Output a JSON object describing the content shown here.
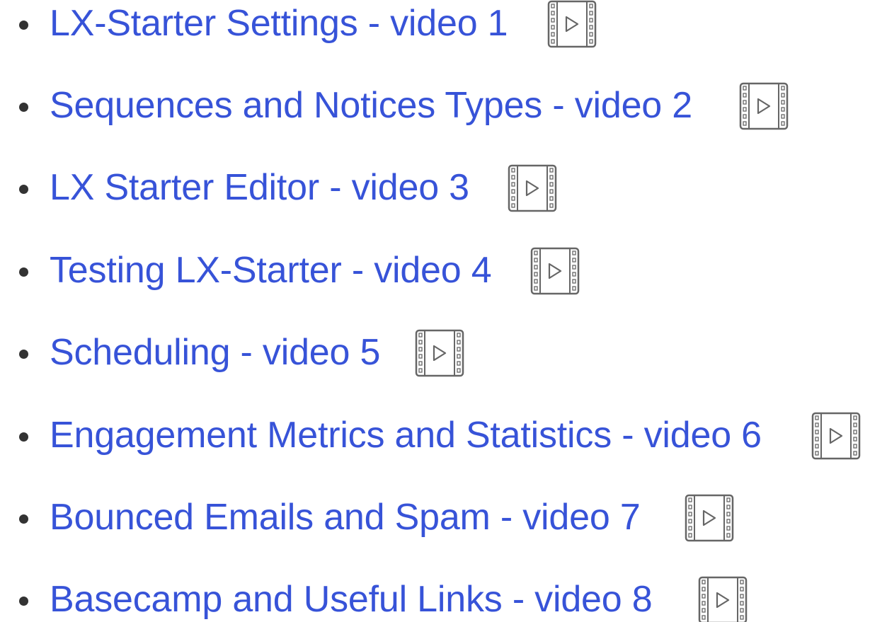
{
  "videos": [
    {
      "label": "LX-Starter Settings - video 1",
      "icon": "video-icon"
    },
    {
      "label": "Sequences and Notices Types - video 2",
      "icon": "video-icon"
    },
    {
      "label": "LX Starter Editor - video 3",
      "icon": "video-icon"
    },
    {
      "label": "Testing LX-Starter - video 4",
      "icon": "video-icon"
    },
    {
      "label": "Scheduling - video 5",
      "icon": "video-icon"
    },
    {
      "label": "Engagement Metrics and Statistics - video 6",
      "icon": "video-icon"
    },
    {
      "label": "Bounced Emails and Spam - video 7",
      "icon": "video-icon"
    },
    {
      "label": "Basecamp and Useful Links - video 8",
      "icon": "video-icon"
    }
  ],
  "colors": {
    "link": "#3753d8",
    "bullet": "#333333",
    "icon_stroke": "#666666"
  }
}
